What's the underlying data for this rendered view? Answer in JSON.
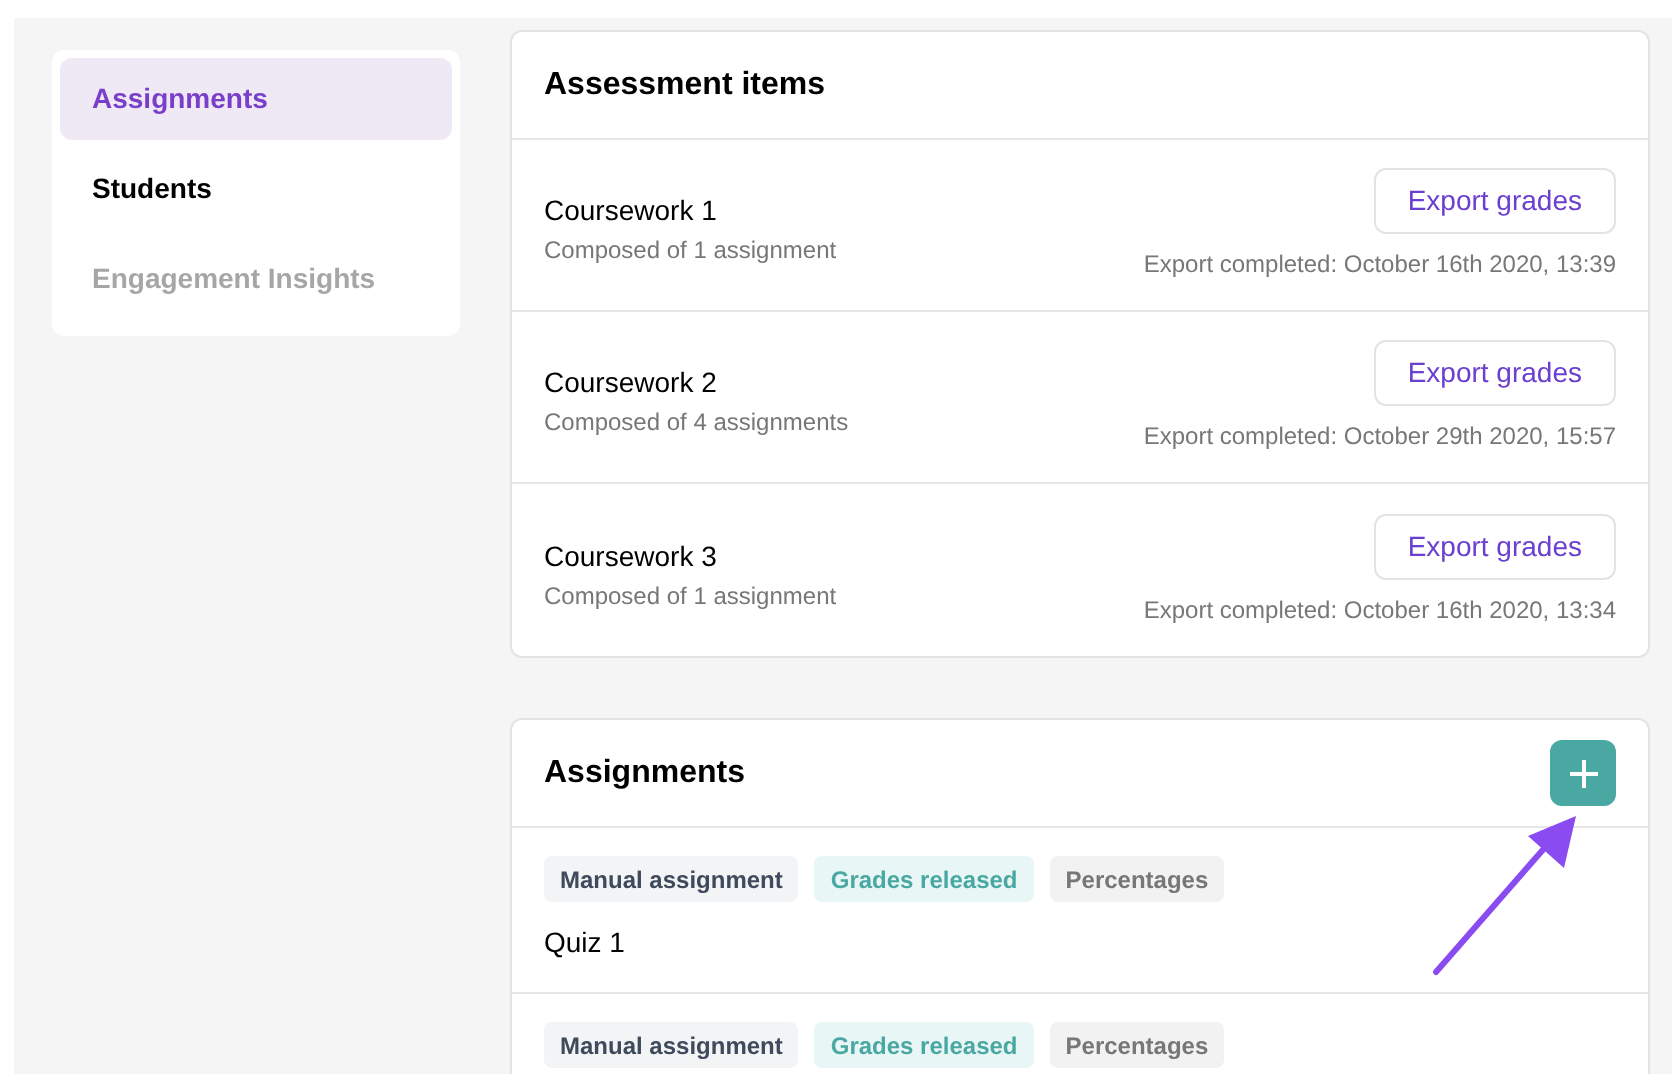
{
  "sidebar": {
    "items": [
      {
        "label": "Assignments",
        "selected": true,
        "disabled": false
      },
      {
        "label": "Students",
        "selected": false,
        "disabled": false
      },
      {
        "label": "Engagement Insights",
        "selected": false,
        "disabled": true
      }
    ]
  },
  "assessment_items": {
    "title": "Assessment items",
    "rows": [
      {
        "name": "Coursework 1",
        "subtitle": "Composed of 1 assignment",
        "button": "Export grades",
        "status": "Export completed: October 16th 2020, 13:39"
      },
      {
        "name": "Coursework 2",
        "subtitle": "Composed of 4 assignments",
        "button": "Export grades",
        "status": "Export completed: October 29th 2020, 15:57"
      },
      {
        "name": "Coursework 3",
        "subtitle": "Composed of 1 assignment",
        "button": "Export grades",
        "status": "Export completed: October 16th 2020, 13:34"
      }
    ]
  },
  "assignments": {
    "title": "Assignments",
    "rows": [
      {
        "tags": [
          {
            "label": "Manual assignment",
            "kind": "type"
          },
          {
            "label": "Grades released",
            "kind": "status"
          },
          {
            "label": "Percentages",
            "kind": "scale"
          }
        ],
        "name": "Quiz 1"
      },
      {
        "tags": [
          {
            "label": "Manual assignment",
            "kind": "type"
          },
          {
            "label": "Grades released",
            "kind": "status"
          },
          {
            "label": "Percentages",
            "kind": "scale"
          }
        ]
      }
    ]
  }
}
